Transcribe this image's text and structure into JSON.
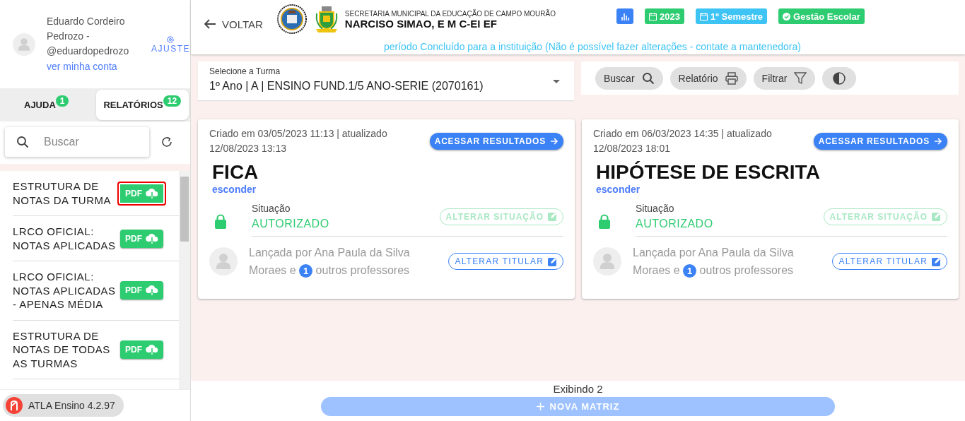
{
  "user": {
    "name": "Eduardo Cordeiro Pedrozo - @eduardopedrozo",
    "account_link": "ver minha conta",
    "settings_label": "AJUSTE"
  },
  "sidebar_tabs": [
    {
      "label": "AJUDA",
      "count": "1",
      "selected": false
    },
    {
      "label": "RELATÓRIOS",
      "count": "12",
      "selected": true
    }
  ],
  "search": {
    "placeholder": "Buscar"
  },
  "reports": [
    {
      "title": "ESTRUTURA DE NOTAS DA TURMA",
      "button": "PDF",
      "highlighted": true
    },
    {
      "title": "LRCO OFICIAL: NOTAS APLICADAS",
      "button": "PDF",
      "highlighted": false
    },
    {
      "title": "LRCO OFICIAL: NOTAS APLICADAS - APENAS MÉDIA",
      "button": "PDF",
      "highlighted": false
    },
    {
      "title": "ESTRUTURA DE NOTAS DE TODAS AS TURMAS",
      "button": "PDF",
      "highlighted": false
    }
  ],
  "version": "ATLA Ensino 4.2.97",
  "header": {
    "back": "VOLTAR",
    "secretariat": "SECRETARIA MUNICIPAL DA EDUCAÇÃO DE CAMPO MOURÃO",
    "school": "NARCISO SIMAO, E M C-EI EF",
    "chips": [
      {
        "kind": "stats",
        "color": "#3b82f6"
      },
      {
        "kind": "calendar",
        "label": "2023",
        "color": "#2ecc71"
      },
      {
        "kind": "calendar",
        "label": "1º Semestre",
        "color": "#3ec3f5"
      },
      {
        "kind": "check",
        "label": "Gestão Escolar",
        "color": "#2ecc71"
      }
    ],
    "notice": "período Concluído para a instituição (Não é possível fazer alterações - contate a mantenedora)"
  },
  "class_select": {
    "label": "Selecione a Turma",
    "value": "1º Ano | A | ENSINO FUND.1/5 ANO-SERIE (2070161)"
  },
  "toolbar": [
    {
      "kind": "search",
      "label": "Buscar"
    },
    {
      "kind": "print",
      "label": "Relatório"
    },
    {
      "kind": "filter",
      "label": "Filtrar"
    },
    {
      "kind": "contrast"
    }
  ],
  "cards": [
    {
      "meta": "Criado em 03/05/2023 11:13 | atualizado 12/08/2023 13:13",
      "action": "ACESSAR RESULTADOS",
      "title": "FICA",
      "toggle": "esconder",
      "status_label": "Situação",
      "status": "AUTORIZADO",
      "change_status": "ALTERAR SITUAÇÃO",
      "change_status_disabled": true,
      "author_before": "Lançada por Ana Paula da Silva Moraes e",
      "others_count": "1",
      "author_after": "outros professores",
      "change_owner": "ALTERAR TITULAR"
    },
    {
      "meta": "Criado em 06/03/2023 14:35 | atualizado 12/08/2023 18:01",
      "action": "ACESSAR RESULTADOS",
      "title": "HIPÓTESE DE ESCRITA",
      "toggle": "esconder",
      "status_label": "Situação",
      "status": "AUTORIZADO",
      "change_status": "ALTERAR SITUAÇÃO",
      "change_status_disabled": true,
      "author_before": "Lançada por Ana Paula da Silva Moraes e",
      "others_count": "1",
      "author_after": "outros professores",
      "change_owner": "ALTERAR TITULAR"
    }
  ],
  "footer": {
    "count": "Exibindo 2",
    "new_button": "NOVA MATRIZ"
  }
}
